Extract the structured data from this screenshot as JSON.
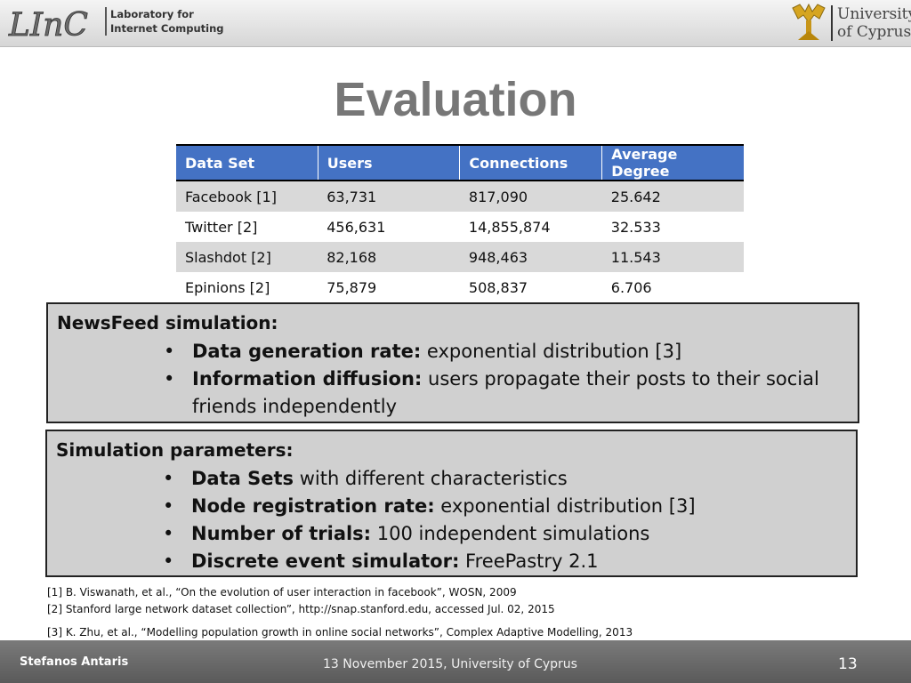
{
  "header": {
    "lab_logo_text": "LInC",
    "lab_name_line1": "Laboratory for",
    "lab_name_line2": "Internet Computing",
    "university_line1": "University",
    "university_line2": "of Cyprus"
  },
  "slide": {
    "title": "Evaluation"
  },
  "table": {
    "headers": [
      "Data Set",
      "Users",
      "Connections",
      "Average Degree"
    ],
    "rows": [
      [
        "Facebook [1]",
        "63,731",
        "817,090",
        "25.642"
      ],
      [
        "Twitter [2]",
        "456,631",
        "14,855,874",
        "32.533"
      ],
      [
        "Slashdot [2]",
        "82,168",
        "948,463",
        "11.543"
      ],
      [
        "Epinions [2]",
        "75,879",
        "508,837",
        "6.706"
      ]
    ]
  },
  "newsfeed_box": {
    "heading": "NewsFeed simulation:",
    "bullets": [
      {
        "bold": "Data generation rate:",
        "text": " exponential distribution [3]"
      },
      {
        "bold": "Information diffusion:",
        "text": " users propagate their posts to their social friends independently"
      }
    ]
  },
  "params_box": {
    "heading": "Simulation parameters:",
    "bullets": [
      {
        "bold": "Data Sets",
        "text": " with different characteristics"
      },
      {
        "bold": "Node registration rate:",
        "text": " exponential distribution [3]"
      },
      {
        "bold": "Number of trials:",
        "text": " 100 independent simulations"
      },
      {
        "bold": "Discrete event simulator:",
        "text": " FreePastry 2.1"
      }
    ]
  },
  "references": [
    "[1] B. Viswanath, et al., “On the evolution of user interaction in facebook”, WOSN, 2009",
    "[2] Stanford large network dataset collection”, http://snap.stanford.edu, accessed Jul. 02, 2015",
    "[3] K. Zhu, et al., “Modelling population growth in online social networks”, Complex Adaptive Modelling, 2013"
  ],
  "footer": {
    "author": "Stefanos Antaris",
    "date": "13 November 2015, University of Cyprus",
    "page_number": "13"
  },
  "colors": {
    "table_header": "#4472c4",
    "box_background": "#d0d0d0",
    "title": "#777777"
  }
}
